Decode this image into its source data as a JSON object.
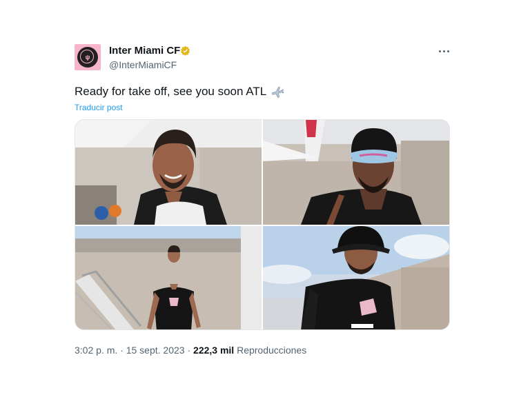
{
  "account": {
    "name": "Inter Miami CF",
    "handle": "@InterMiamiCF",
    "verified_color": "#e2b719",
    "avatar_color": "#f7b5cd"
  },
  "post": {
    "text": "Ready for take off, see you soon ATL",
    "emoji": "airplane-icon",
    "translate_label": "Traducir post",
    "link_color": "#1d9bf0"
  },
  "meta": {
    "time": "3:02 p. m.",
    "date": "15 sept. 2023",
    "separator": "·",
    "views_count": "222,3 mil",
    "views_label": "Reproducciones"
  },
  "media": [
    {
      "description": "player-photo-1"
    },
    {
      "description": "player-photo-2"
    },
    {
      "description": "player-photo-3"
    },
    {
      "description": "player-photo-4"
    }
  ]
}
